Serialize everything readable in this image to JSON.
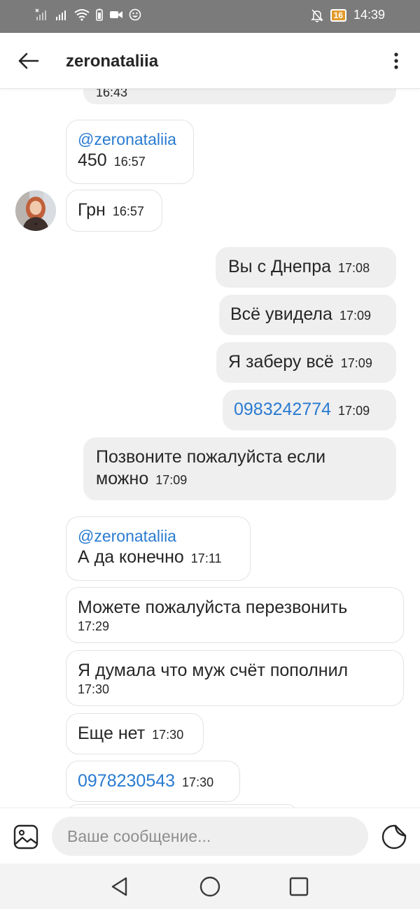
{
  "status_bar": {
    "time": "14:39",
    "battery": "16",
    "icons": [
      "no-sim-signal-icon",
      "signal-icon",
      "wifi-icon",
      "battery-saver-icon",
      "video-call-icon",
      "face-icon",
      "bell-off-icon"
    ]
  },
  "header": {
    "title": "zeronataliia",
    "back_icon": "arrow-left-icon",
    "more_icon": "vertical-dots-icon"
  },
  "messages": [
    {
      "side": "out",
      "text": "",
      "time": "16:43"
    },
    {
      "side": "in",
      "mention": "@zeronataliia",
      "text": "450",
      "time": "16:57"
    },
    {
      "side": "in",
      "text": "Грн",
      "time": "16:57"
    },
    {
      "side": "out",
      "text": "Вы с Днепра",
      "time": "17:08"
    },
    {
      "side": "out",
      "text": "Всё увидела",
      "time": "17:09"
    },
    {
      "side": "out",
      "text": "Я заберу всё",
      "time": "17:09"
    },
    {
      "side": "out",
      "text": "0983242774",
      "time": "17:09",
      "link": true
    },
    {
      "side": "out",
      "text": "Позвоните пожалуйста если",
      "text2": "можно",
      "time": "17:09"
    },
    {
      "side": "in",
      "mention": "@zeronataliia",
      "text": "А да конечно",
      "time": "17:11"
    },
    {
      "side": "in",
      "text": "Можете пожалуйста перезвонить",
      "time": "17:29"
    },
    {
      "side": "in",
      "text": "Я думала что муж счёт пополнил",
      "time": "17:30"
    },
    {
      "side": "in",
      "text": "Еще нет",
      "time": "17:30"
    },
    {
      "side": "in",
      "text": "0978230543",
      "time": "17:30",
      "link": true
    }
  ],
  "composer": {
    "placeholder": "Ваше сообщение...",
    "left_icon": "gallery-icon",
    "right_icon": "sticker-icon"
  },
  "nav": {
    "icons": [
      "back-triangle-icon",
      "home-circle-icon",
      "recents-square-icon"
    ]
  },
  "colors": {
    "status_bar": "#7b7b7b",
    "link": "#2a7bd1",
    "outgoing_bubble": "#efefef",
    "incoming_border": "#e2e2e2"
  }
}
